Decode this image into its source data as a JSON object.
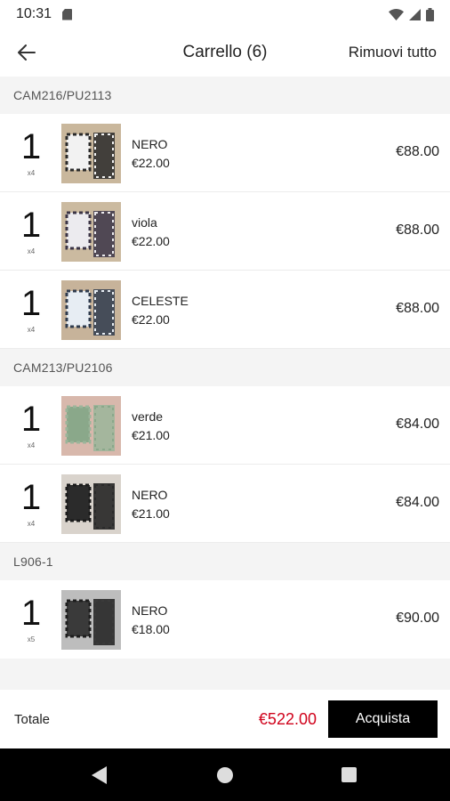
{
  "status_bar": {
    "time": "10:31"
  },
  "header": {
    "title": "Carrello (6)",
    "remove_all_label": "Rimuovi tutto"
  },
  "groups": [
    {
      "code": "CAM216/PU2113",
      "items": [
        {
          "qty": "1",
          "pack": "x4",
          "variant": "NERO",
          "unit_price": "€22.00",
          "total": "€88.00",
          "colors": [
            "#c9b79c",
            "#2a2a2a",
            "#f2f2f2"
          ]
        },
        {
          "qty": "1",
          "pack": "x4",
          "variant": "viola",
          "unit_price": "€22.00",
          "total": "€88.00",
          "colors": [
            "#cbbaa0",
            "#3b3446",
            "#ecebef"
          ]
        },
        {
          "qty": "1",
          "pack": "x4",
          "variant": "CELESTE",
          "unit_price": "€22.00",
          "total": "€88.00",
          "colors": [
            "#c7b39a",
            "#2f3b4d",
            "#e7edf3"
          ]
        }
      ]
    },
    {
      "code": "CAM213/PU2106",
      "items": [
        {
          "qty": "1",
          "pack": "x4",
          "variant": "verde",
          "unit_price": "€21.00",
          "total": "€84.00",
          "colors": [
            "#d8b8ac",
            "#9bb59a",
            "#8aa88a"
          ]
        },
        {
          "qty": "1",
          "pack": "x4",
          "variant": "NERO",
          "unit_price": "€21.00",
          "total": "€84.00",
          "colors": [
            "#d9d3cc",
            "#1b1b1b",
            "#2b2b2b"
          ]
        }
      ]
    },
    {
      "code": "L906-1",
      "items": [
        {
          "qty": "1",
          "pack": "x5",
          "variant": "NERO",
          "unit_price": "€18.00",
          "total": "€90.00",
          "colors": [
            "#bdbdbd",
            "#1e1e1e",
            "#3a3a3a"
          ]
        }
      ]
    }
  ],
  "footer": {
    "total_label": "Totale",
    "total_value": "€522.00",
    "buy_label": "Acquista"
  },
  "icons": {
    "back": "arrow-left-icon",
    "sd": "sd-card-icon",
    "wifi": "wifi-icon",
    "signal": "signal-icon",
    "battery": "battery-icon"
  },
  "colors": {
    "accent_price": "#d0021b",
    "button_bg": "#000000"
  }
}
